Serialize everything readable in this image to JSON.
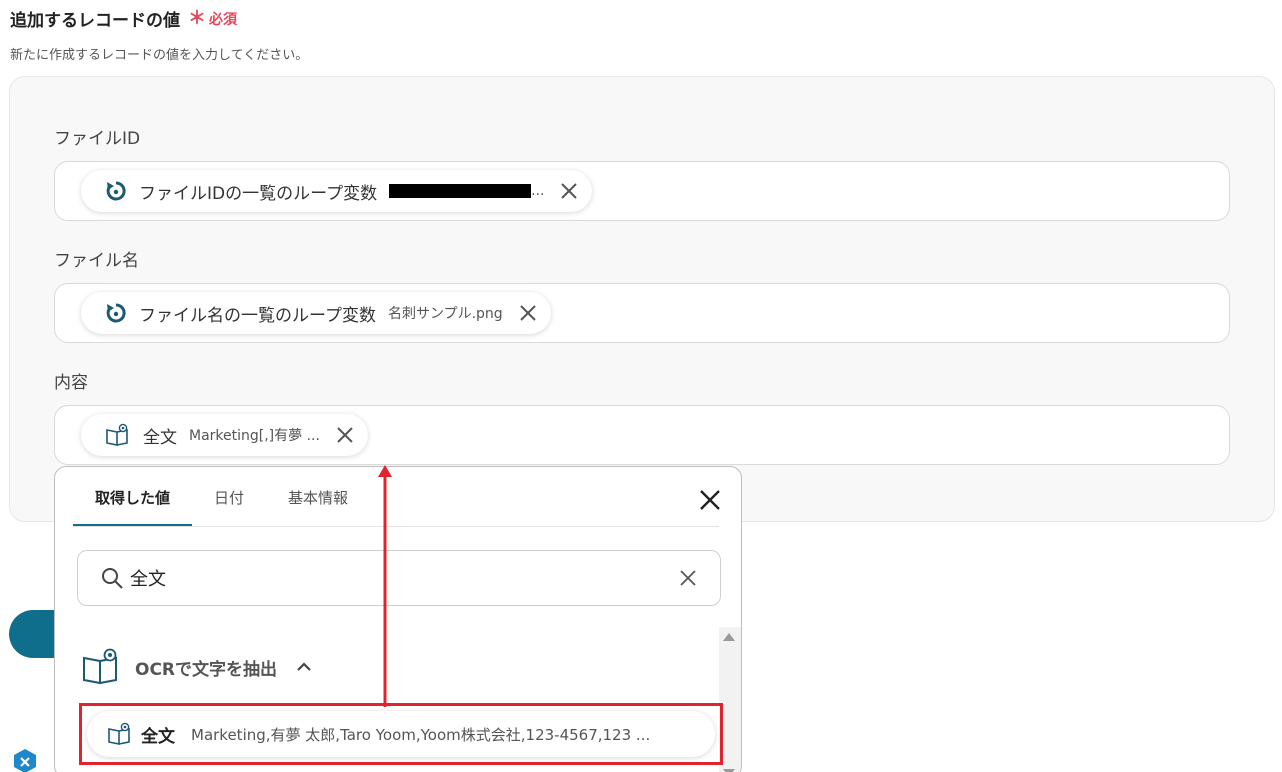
{
  "section": {
    "title": "追加するレコードの値",
    "required_mark": "＊",
    "required_label": "必須",
    "description": "新たに作成するレコードの値を入力してください。"
  },
  "fields": [
    {
      "label": "ファイルID",
      "chip": {
        "icon": "loop-icon",
        "name": "ファイルIDの一覧のループ変数",
        "value": "..."
      }
    },
    {
      "label": "ファイル名",
      "chip": {
        "icon": "loop-icon",
        "name": "ファイル名の一覧のループ変数",
        "value": "名刺サンプル.png"
      }
    },
    {
      "label": "内容",
      "chip": {
        "icon": "ocr-book-icon",
        "name": "全文",
        "value": "Marketing[,]有夢 ..."
      }
    }
  ],
  "dropdown": {
    "tabs": [
      {
        "label": "取得した値",
        "active": true
      },
      {
        "label": "日付",
        "active": false
      },
      {
        "label": "基本情報",
        "active": false
      }
    ],
    "search_value": "全文",
    "group_label": "OCRで文字を抽出",
    "option": {
      "name": "全文",
      "value": "Marketing,有夢 太郎,Taro Yoom,Yoom株式会社,123-4567,123 ..."
    }
  },
  "colors": {
    "accent": "#0e6e8c",
    "required": "#e8485a",
    "highlight": "#e0242f"
  }
}
